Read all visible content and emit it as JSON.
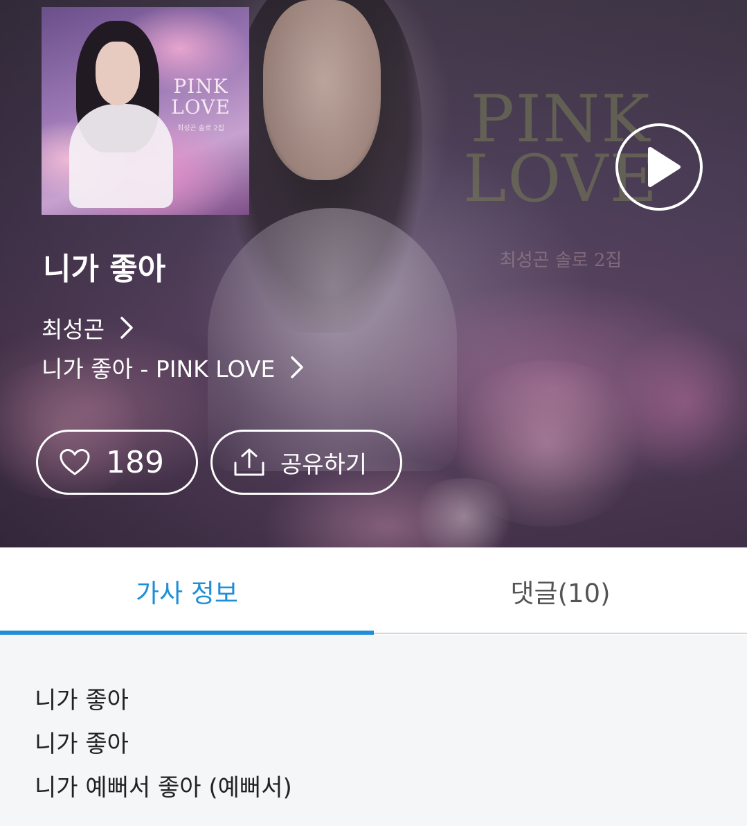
{
  "album_art": {
    "title_line1": "PINK",
    "title_line2": "LOVE",
    "subtitle": "최성곤 솔로 2집"
  },
  "song": {
    "title": "니가 좋아",
    "artist": "최성곤",
    "album": "니가 좋아 - PINK LOVE"
  },
  "actions": {
    "like_count": "189",
    "share_label": "공유하기"
  },
  "tabs": {
    "lyrics": "가사 정보",
    "comments": "댓글(10)",
    "active": "lyrics"
  },
  "lyrics": [
    "니가 좋아",
    "니가 좋아",
    "니가 예뻐서 좋아 (예뻐서)"
  ],
  "colors": {
    "accent": "#1e8fd6",
    "tab_inactive_text": "#555555",
    "lyrics_background": "#f5f6f8"
  },
  "icons": {
    "play": "play-icon",
    "artist_chevron": "chevron-right-icon",
    "album_chevron": "chevron-right-icon",
    "like": "heart-icon",
    "share": "share-icon"
  }
}
